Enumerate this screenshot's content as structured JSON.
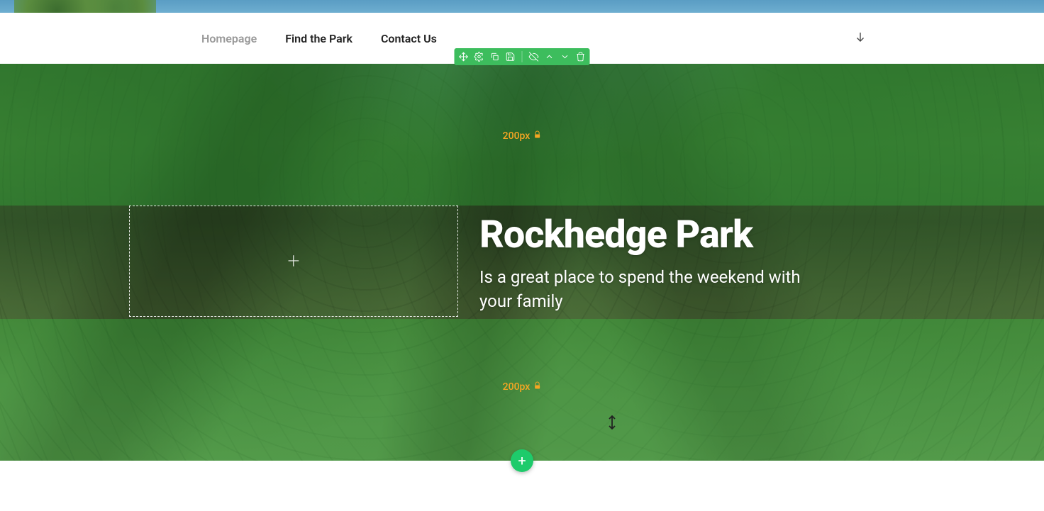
{
  "nav": {
    "items": [
      {
        "label": "Homepage",
        "active": true
      },
      {
        "label": "Find the Park",
        "active": false
      },
      {
        "label": "Contact Us",
        "active": false
      }
    ]
  },
  "toolbar": {
    "icons": [
      "move",
      "settings",
      "duplicate",
      "save",
      "hide",
      "move-up",
      "move-down",
      "delete"
    ]
  },
  "spacer": {
    "top_label": "200px",
    "bottom_label": "200px"
  },
  "hero": {
    "title": "Rockhedge Park",
    "subtitle": "Is a great place to spend the weekend with your family"
  },
  "colors": {
    "accent": "#3dbd5d",
    "warning": "#f5a623",
    "add_btn": "#1ecb6b"
  }
}
